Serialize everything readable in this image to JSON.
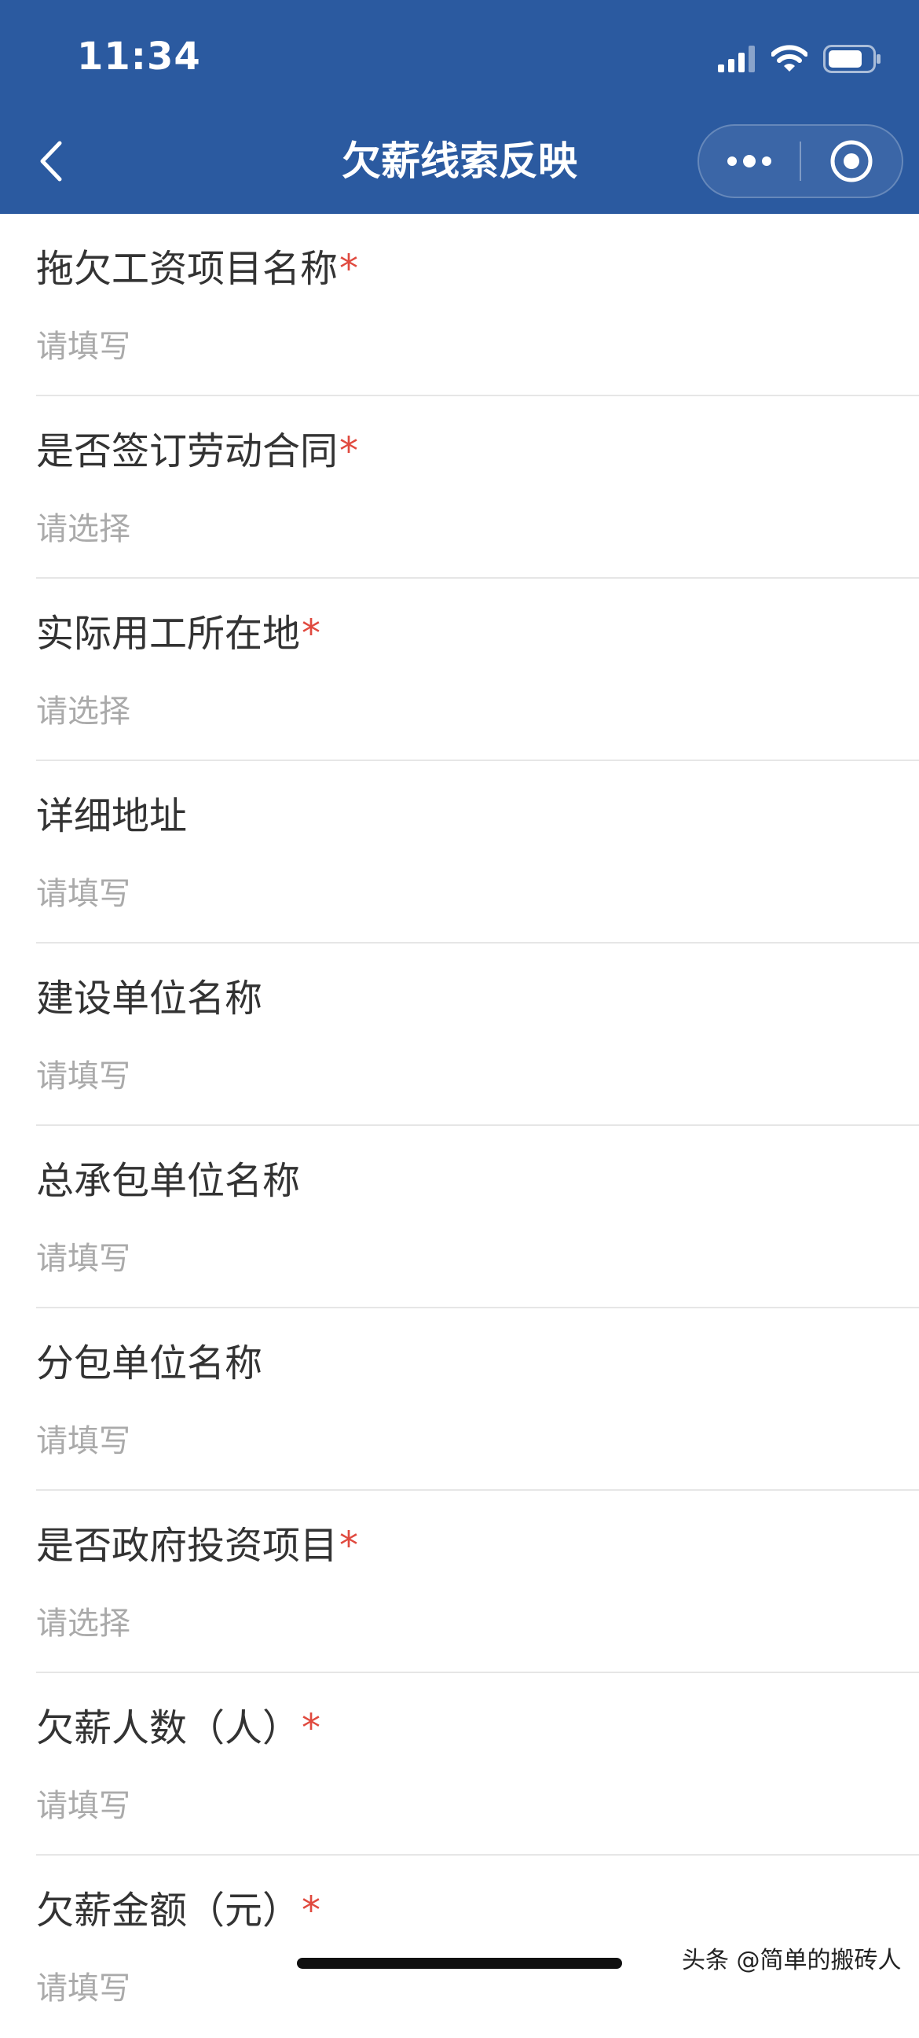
{
  "status_bar": {
    "time": "11:34"
  },
  "nav": {
    "title": "欠薪线索反映",
    "back_icon": "chevron-left-icon",
    "more_icon": "more-dots-icon",
    "close_icon": "target-circle-icon"
  },
  "colors": {
    "header_bg": "#2b5aa0",
    "required": "#e04a3f",
    "label": "#333333",
    "placeholder": "#aaaaaa"
  },
  "form": {
    "fields": [
      {
        "label": "拖欠工资项目名称",
        "required": true,
        "placeholder": "请填写"
      },
      {
        "label": "是否签订劳动合同",
        "required": true,
        "placeholder": "请选择"
      },
      {
        "label": "实际用工所在地",
        "required": true,
        "placeholder": "请选择"
      },
      {
        "label": "详细地址",
        "required": false,
        "placeholder": "请填写"
      },
      {
        "label": "建设单位名称",
        "required": false,
        "placeholder": "请填写"
      },
      {
        "label": "总承包单位名称",
        "required": false,
        "placeholder": "请填写"
      },
      {
        "label": "分包单位名称",
        "required": false,
        "placeholder": "请填写"
      },
      {
        "label": "是否政府投资项目",
        "required": true,
        "placeholder": "请选择"
      },
      {
        "label": "欠薪人数（人）",
        "required": true,
        "placeholder": "请填写"
      },
      {
        "label": "欠薪金额（元）",
        "required": true,
        "placeholder": "请填写"
      }
    ],
    "required_mark": "*"
  },
  "watermark": "头条 @简单的搬砖人"
}
